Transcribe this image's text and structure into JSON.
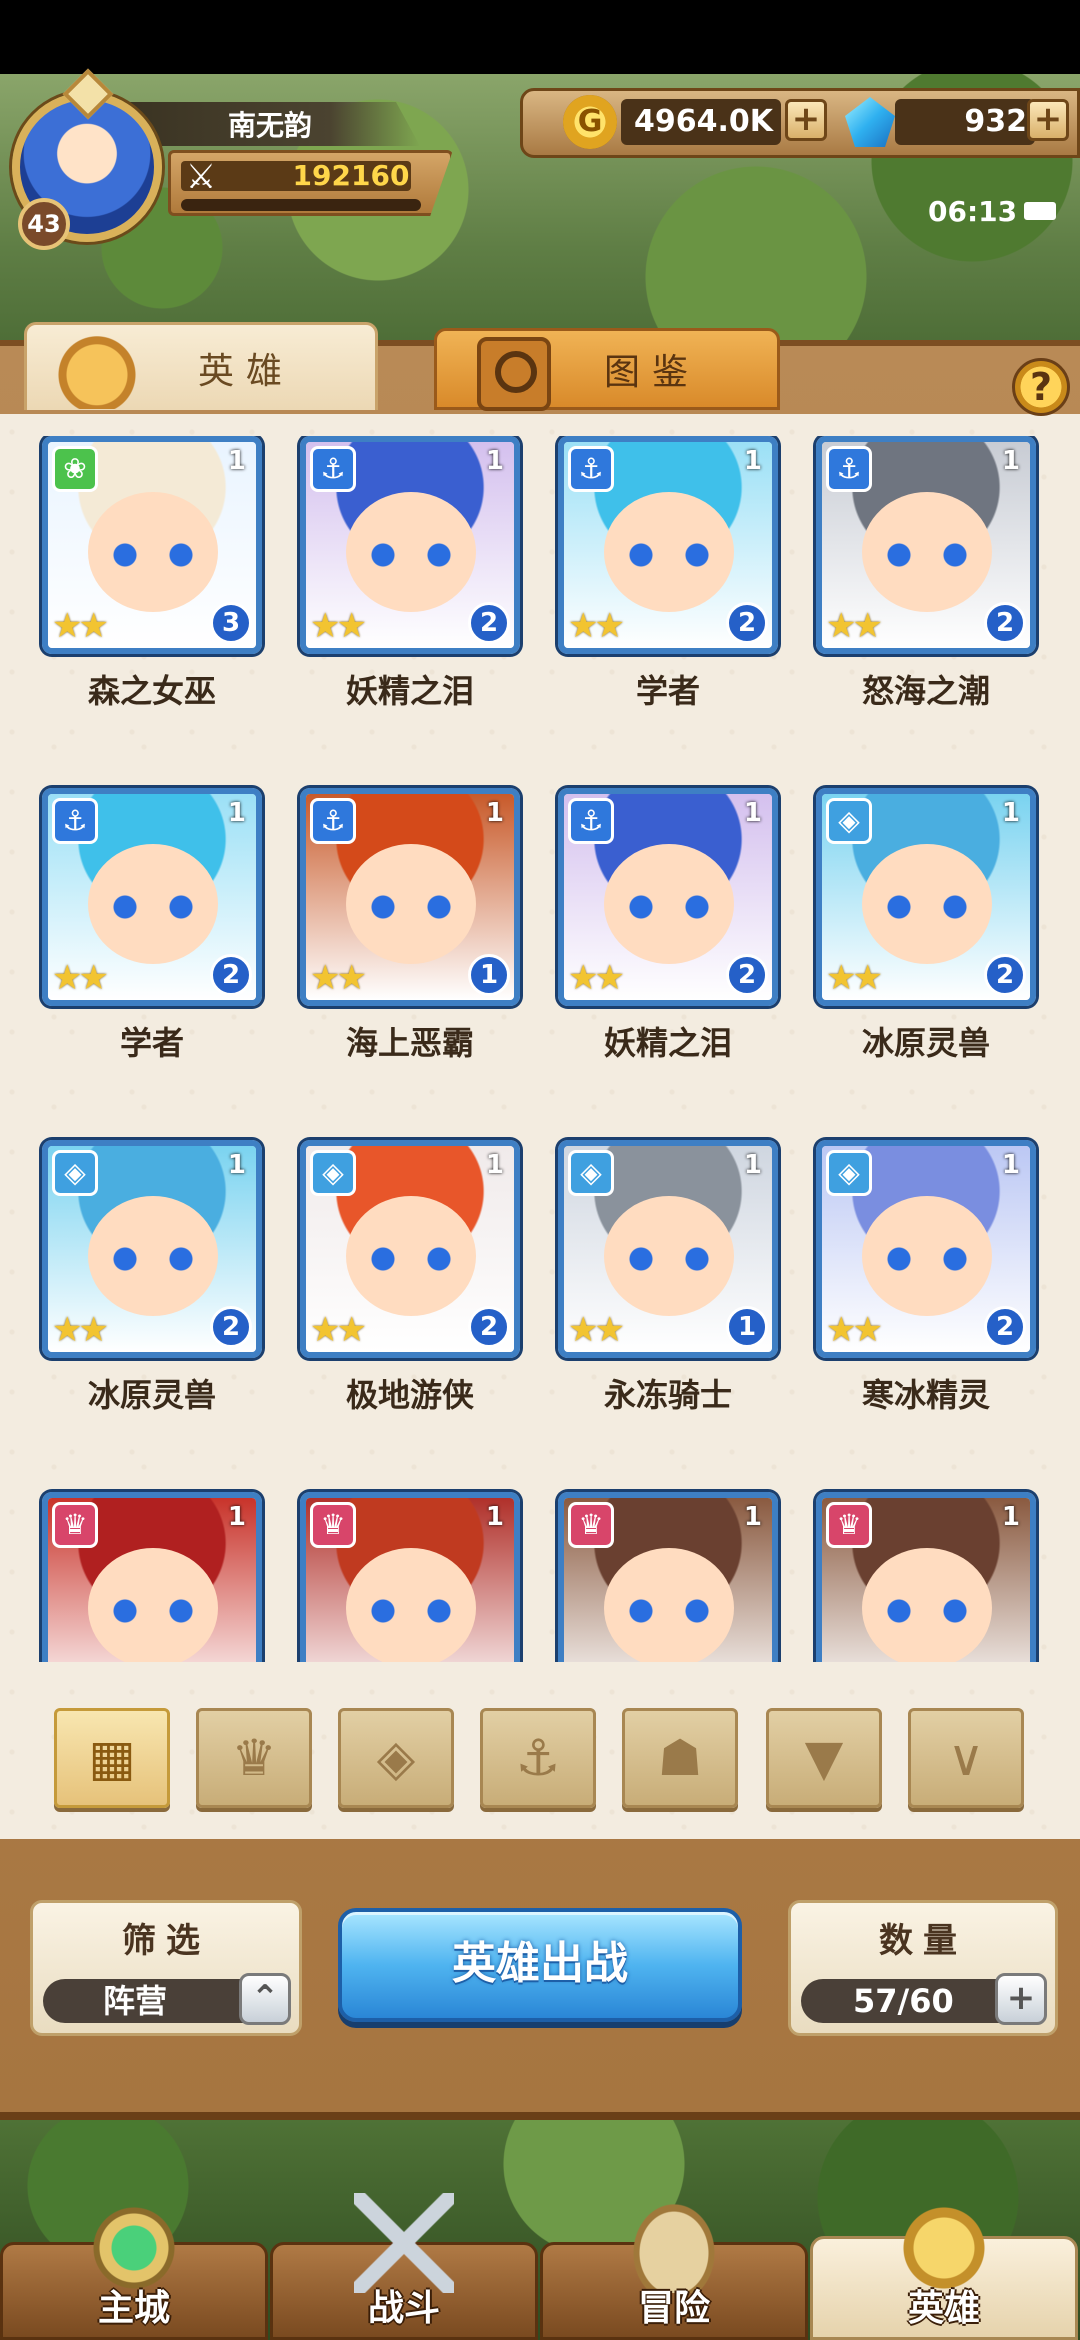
{
  "player": {
    "name": "南无韵",
    "level": "43",
    "power": "192160"
  },
  "currency": {
    "gold": "4964.0K",
    "gems": "932"
  },
  "status": {
    "time": "06:13"
  },
  "tabs": {
    "heroes": "英雄",
    "codex": "图鉴"
  },
  "heroes": [
    {
      "name": "森之女巫",
      "stage": "1",
      "grade": "3",
      "stars": "★★",
      "faction": "forest",
      "color": "#4cc24c",
      "symbol": "❀"
    },
    {
      "name": "妖精之泪",
      "stage": "1",
      "grade": "2",
      "stars": "★★",
      "faction": "ocean",
      "color": "#2f78dc",
      "symbol": "⚓"
    },
    {
      "name": "学者",
      "stage": "1",
      "grade": "2",
      "stars": "★★",
      "faction": "ocean",
      "color": "#2f78dc",
      "symbol": "⚓"
    },
    {
      "name": "怒海之潮",
      "stage": "1",
      "grade": "2",
      "stars": "★★",
      "faction": "ocean",
      "color": "#2f78dc",
      "symbol": "⚓"
    },
    {
      "name": "学者",
      "stage": "1",
      "grade": "2",
      "stars": "★★",
      "faction": "ocean",
      "color": "#2f78dc",
      "symbol": "⚓"
    },
    {
      "name": "海上恶霸",
      "stage": "1",
      "grade": "1",
      "stars": "★★",
      "faction": "ocean",
      "color": "#2f78dc",
      "symbol": "⚓"
    },
    {
      "name": "妖精之泪",
      "stage": "1",
      "grade": "2",
      "stars": "★★",
      "faction": "ocean",
      "color": "#2f78dc",
      "symbol": "⚓"
    },
    {
      "name": "冰原灵兽",
      "stage": "1",
      "grade": "2",
      "stars": "★★",
      "faction": "ice",
      "color": "#3fa0e0",
      "symbol": "◈"
    },
    {
      "name": "冰原灵兽",
      "stage": "1",
      "grade": "2",
      "stars": "★★",
      "faction": "ice",
      "color": "#3fa0e0",
      "symbol": "◈"
    },
    {
      "name": "极地游侠",
      "stage": "1",
      "grade": "2",
      "stars": "★★",
      "faction": "ice",
      "color": "#3fa0e0",
      "symbol": "◈"
    },
    {
      "name": "永冻骑士",
      "stage": "1",
      "grade": "1",
      "stars": "★★",
      "faction": "ice",
      "color": "#3fa0e0",
      "symbol": "◈"
    },
    {
      "name": "寒冰精灵",
      "stage": "1",
      "grade": "2",
      "stars": "★★",
      "faction": "ice",
      "color": "#3fa0e0",
      "symbol": "◈"
    },
    {
      "name": "",
      "stage": "1",
      "grade": "",
      "stars": "",
      "faction": "fire",
      "color": "#d8456a",
      "symbol": "♛"
    },
    {
      "name": "",
      "stage": "1",
      "grade": "",
      "stars": "",
      "faction": "fire",
      "color": "#d8456a",
      "symbol": "♛"
    },
    {
      "name": "",
      "stage": "1",
      "grade": "",
      "stars": "",
      "faction": "fire",
      "color": "#d8456a",
      "symbol": "♛"
    },
    {
      "name": "",
      "stage": "1",
      "grade": "",
      "stars": "",
      "faction": "fire",
      "color": "#d8456a",
      "symbol": "♛"
    }
  ],
  "filters": [
    {
      "icon": "grid-icon",
      "glyph": "▦"
    },
    {
      "icon": "flame-faction-icon",
      "glyph": "♛"
    },
    {
      "icon": "ice-faction-icon",
      "glyph": "◈"
    },
    {
      "icon": "anchor-faction-icon",
      "glyph": "⚓"
    },
    {
      "icon": "beast-faction-icon",
      "glyph": "☗"
    },
    {
      "icon": "dark-faction-icon",
      "glyph": "▼"
    },
    {
      "icon": "light-faction-icon",
      "glyph": "∨"
    }
  ],
  "controls": {
    "filter_title": "筛选",
    "filter_value": "阵营",
    "deploy": "英雄出战",
    "count_title": "数量",
    "count_value": "57/60"
  },
  "nav": [
    {
      "label": "主城",
      "icon": "castle-icon"
    },
    {
      "label": "战斗",
      "icon": "swords-icon"
    },
    {
      "label": "冒险",
      "icon": "scroll-icon"
    },
    {
      "label": "英雄",
      "icon": "helm-gold-icon"
    }
  ]
}
